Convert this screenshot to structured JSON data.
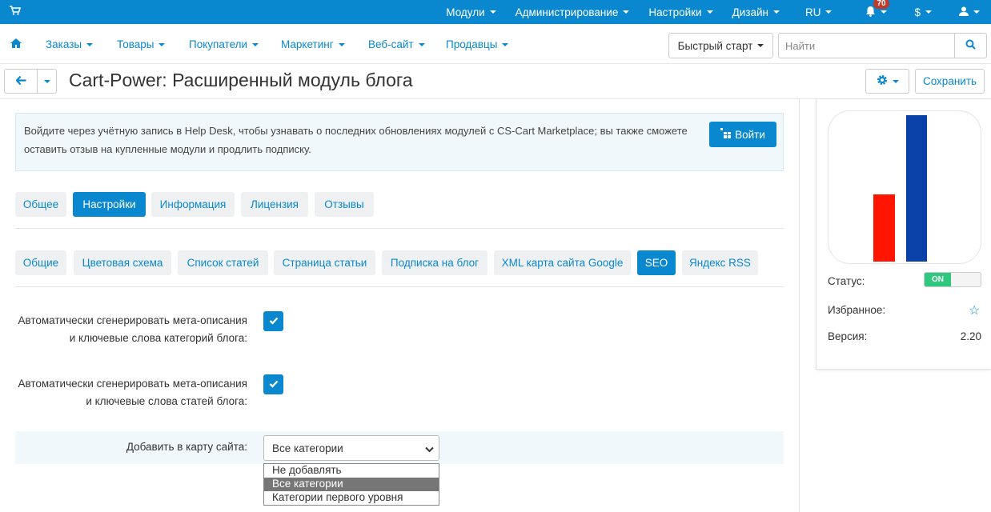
{
  "topbar": {
    "items": [
      "Модули",
      "Администрирование",
      "Настройки",
      "Дизайн",
      "RU"
    ],
    "notifications_count": "70",
    "currency": "$"
  },
  "mainnav": {
    "items": [
      "Заказы",
      "Товары",
      "Покупатели",
      "Маркетинг",
      "Веб-сайт",
      "Продавцы"
    ],
    "quick_start": "Быстрый старт",
    "search_placeholder": "Найти"
  },
  "titlebar": {
    "title": "Cart-Power: Расширенный модуль блога",
    "save_label": "Сохранить"
  },
  "notice": {
    "text": "Войдите через учётную запись в Help Desk, чтобы узнавать о последних обновлениях модулей с CS-Cart Marketplace; вы также сможете оставить отзыв на купленные модули и продлить подписку.",
    "login_label": "Войти"
  },
  "tabs": [
    "Общее",
    "Настройки",
    "Информация",
    "Лицензия",
    "Отзывы"
  ],
  "subtabs": [
    "Общие",
    "Цветовая схема",
    "Список статей",
    "Страница статьи",
    "Подписка на блог",
    "XML карта сайта Google",
    "SEO",
    "Яндекс RSS"
  ],
  "settings": {
    "cat_meta_line1": "Автоматически сгенерировать мета-описания",
    "cat_meta_line2": "и ключевые слова категорий блога:",
    "art_meta_line1": "Автоматически сгенерировать мета-описания",
    "art_meta_line2": "и ключевые слова статей блога:",
    "sitemap_label": "Добавить в карту сайта:",
    "sitemap_value": "Все категории",
    "sitemap_options": [
      "Не добавлять",
      "Все категории",
      "Категории первого уровня"
    ]
  },
  "side": {
    "status_label": "Статус:",
    "status_toggle": "ON",
    "favorite_label": "Избранное:",
    "version_label": "Версия:",
    "version_value": "2.20"
  },
  "colors": {
    "accent": "#0a88cf",
    "toggle_on": "#30c77e",
    "logo_red": "#ff1500",
    "logo_blue": "#0a41a8"
  }
}
